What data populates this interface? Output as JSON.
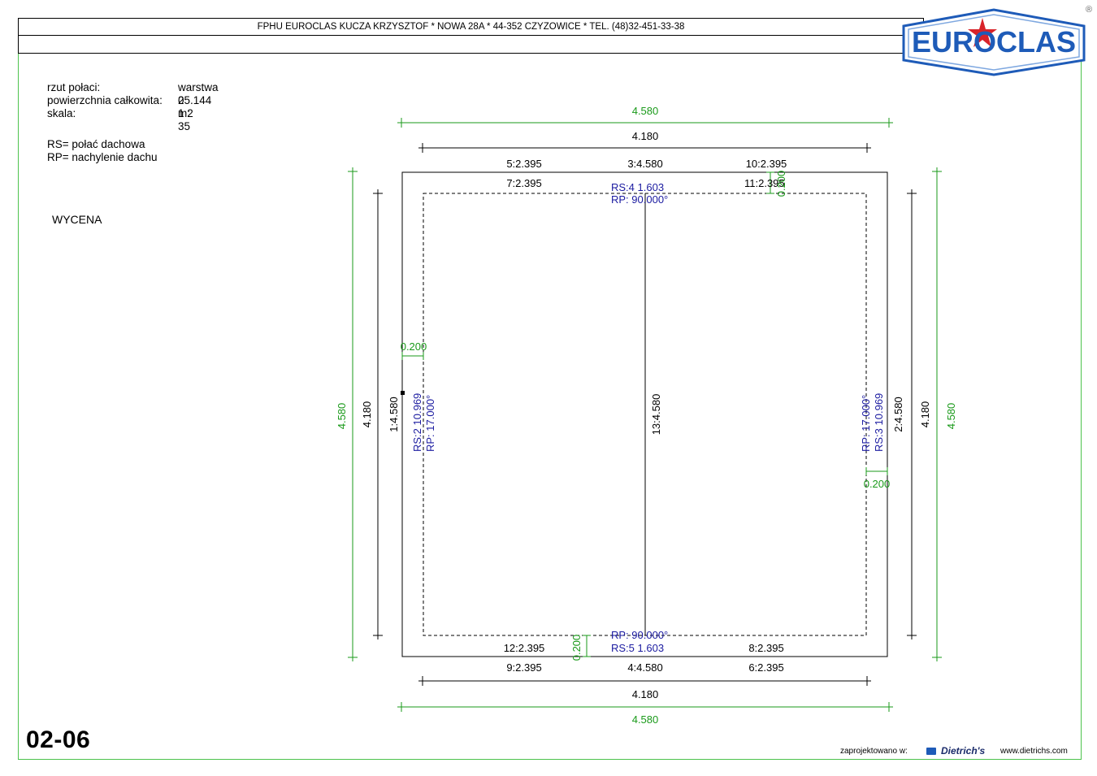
{
  "header": {
    "company_line": "FPHU EUROCLAS KUCZA KRZYSZTOF * NOWA 28A * 44-352 CZYZOWICE * TEL. (48)32-451-33-38",
    "logo_text": "EUROCLAS",
    "registered_mark": "®"
  },
  "info": {
    "label_1": "rzut połaci:",
    "value_1": "warstwa 0",
    "label_2": "powierzchnia całkowita:",
    "value_2": "25.144 m2",
    "label_3": "skala:",
    "value_3": "1 : 35",
    "legend_rs": "RS= połać dachowa",
    "legend_rp": "RP= nachylenie dachu",
    "mode": "WYCENA"
  },
  "drawing": {
    "outer_width": "4.580",
    "inner_width": "4.180",
    "top_left_edge": "5:2.395",
    "top_mid_edge": "3:4.580",
    "top_right_edge": "10:2.395",
    "top_left_inner": "7:2.395",
    "top_right_inner": "11:2.395",
    "top_gap": "0.200",
    "rs_top": "RS:4    1.603",
    "rp_top": "RP:   90.000°",
    "left_outer_height": "4.580",
    "left_inner_height": "4.180",
    "left_edge": "1:4.580",
    "left_gap": "0.200",
    "rs_left": "RS:2   10.969",
    "rp_left": "RP:   17.000°",
    "middle_edge": "13:4.580",
    "right_outer_height": "4.580",
    "right_inner_height": "4.180",
    "right_edge": "2:4.580",
    "right_gap": "0.200",
    "rs_right": "RS:3   10.969",
    "rp_right": "RP:   17.000°",
    "bottom_left_inner": "12:2.395",
    "bottom_right_inner": "8:2.395",
    "bottom_left_edge": "9:2.395",
    "bottom_mid_edge": "4:4.580",
    "bottom_right_edge": "6:2.395",
    "bottom_gap": "0.200",
    "rp_bottom": "RP:   90.000°",
    "rs_bottom": "RS:5    1.603",
    "bottom_inner_width": "4.180",
    "bottom_outer_width": "4.580"
  },
  "footer": {
    "sheet_code": "02-06",
    "designed_in_label": "zaprojektowano w:",
    "software_name": "Dietrich's",
    "website": "www.dietrichs.com"
  },
  "colors": {
    "frame_green": "#4cc24c",
    "dim_green": "#1a9a1a",
    "label_blue": "#1a1aa0",
    "logo_blue": "#1e5bb8",
    "logo_red": "#d8232a"
  }
}
